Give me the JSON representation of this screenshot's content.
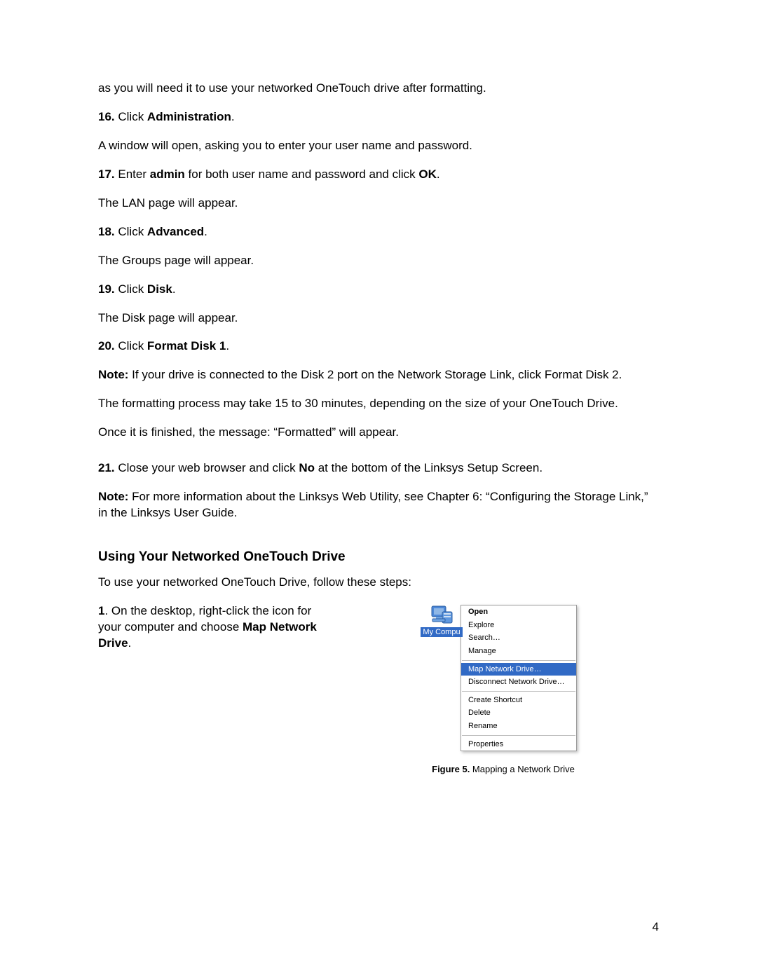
{
  "p_intro": "as you will need it to use your networked OneTouch drive after formatting.",
  "s16_num": "16.",
  "s16_pre": " Click ",
  "s16_bold": "Administration",
  "s16_after": ".",
  "p_window_open": "A window will open, asking you to enter your user name and password.",
  "s17_num": "17.",
  "s17_pre": " Enter ",
  "s17_bold1": "admin",
  "s17_mid": " for both user name and password and click ",
  "s17_bold2": "OK",
  "s17_after": ".",
  "p_lan": "The LAN page will appear.",
  "s18_num": "18.",
  "s18_pre": " Click ",
  "s18_bold": "Advanced",
  "s18_after": ".",
  "p_groups": "The Groups page will appear.",
  "s19_num": "19.",
  "s19_pre": " Click ",
  "s19_bold": "Disk",
  "s19_after": ".",
  "p_disk": "The Disk page will appear.",
  "s20_num": "20.",
  "s20_pre": " Click ",
  "s20_bold": "Format Disk 1",
  "s20_after": ".",
  "note1_label": "Note:",
  "note1_text": " If your drive is connected to the Disk 2 port on the Network Storage Link, click Format Disk 2.",
  "p_formatting": "The formatting process may take 15 to 30 minutes, depending on the size of your OneTouch Drive.",
  "p_formatted": "Once it is finished, the message: “Formatted” will appear.",
  "s21_num": "21.",
  "s21_pre": " Close your web browser and click ",
  "s21_bold": "No",
  "s21_after": " at the bottom of the Linksys Setup Screen.",
  "note2_label": "Note:",
  "note2_text": " For more information about the Linksys Web Utility, see Chapter 6: “Configuring the Storage Link,” in the Linksys User Guide.",
  "heading": "Using Your Networked OneTouch Drive",
  "p_use_intro": "To use your networked OneTouch Drive, follow these steps:",
  "step1_num": "1",
  "step1_pre": ". On the desktop, right-click the icon for your computer and choose ",
  "step1_bold": "Map Network Drive",
  "step1_after": ".",
  "icon_label": "My Compu",
  "ctx_open": "Open",
  "ctx_explore": "Explore",
  "ctx_search": "Search…",
  "ctx_manage": "Manage",
  "ctx_map": "Map Network Drive…",
  "ctx_disconnect": "Disconnect Network Drive…",
  "ctx_shortcut": "Create Shortcut",
  "ctx_delete": "Delete",
  "ctx_rename": "Rename",
  "ctx_properties": "Properties",
  "fig_label": "Figure 5.",
  "fig_text": " Mapping a Network Drive",
  "page_number": "4"
}
